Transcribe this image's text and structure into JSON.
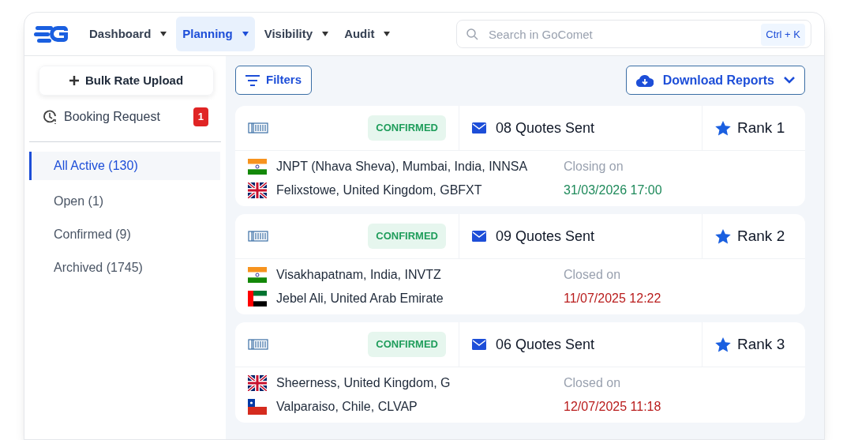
{
  "nav": {
    "items": [
      {
        "label": "Dashboard",
        "selected": false
      },
      {
        "label": "Planning",
        "selected": true
      },
      {
        "label": "Visibility",
        "selected": false
      },
      {
        "label": "Audit",
        "selected": false
      }
    ],
    "search": {
      "placeholder": "Search in GoComet",
      "shortcut": "Ctrl + K"
    }
  },
  "sidebar": {
    "upload_button": "Bulk Rate Upload",
    "booking": {
      "label": "Booking Request",
      "badge": "1"
    },
    "items": [
      {
        "label": "All Active (130)",
        "selected": true
      },
      {
        "label": "Open (1)",
        "selected": false
      },
      {
        "label": "Confirmed (9)",
        "selected": false
      },
      {
        "label": "Archived (1745)",
        "selected": false
      }
    ]
  },
  "toolbar": {
    "filters": "Filters",
    "download": "Download Reports"
  },
  "cards": [
    {
      "status": "CONFIRMED",
      "quotes": "08",
      "quotes_label": "Quotes Sent",
      "rank": "Rank 1",
      "origin": {
        "kind": "india",
        "port": "JNPT (Nhava Sheva), Mumbai, India, INNSA"
      },
      "destination": {
        "kind": "uk",
        "port": "Felixstowe, United Kingdom, GBFXT"
      },
      "deadline_label": "Closing on",
      "deadline": "31/03/2026 17:00",
      "closed": false
    },
    {
      "status": "CONFIRMED",
      "quotes": "09",
      "quotes_label": "Quotes Sent",
      "rank": "Rank 2",
      "origin": {
        "kind": "india",
        "port": "Visakhapatnam, India, INVTZ"
      },
      "destination": {
        "kind": "uae",
        "port": "Jebel Ali, United Arab Emirate"
      },
      "deadline_label": "Closed on",
      "deadline": "11/07/2025 12:22",
      "closed": true
    },
    {
      "status": "CONFIRMED",
      "quotes": "06",
      "quotes_label": "Quotes Sent",
      "rank": "Rank 3",
      "origin": {
        "kind": "uk",
        "port": "Sheerness, United Kingdom, G"
      },
      "destination": {
        "kind": "chile",
        "port": "Valparaiso, Chile, CLVAP"
      },
      "deadline_label": "Closed on",
      "deadline": "12/07/2025 11:18",
      "closed": true
    }
  ]
}
